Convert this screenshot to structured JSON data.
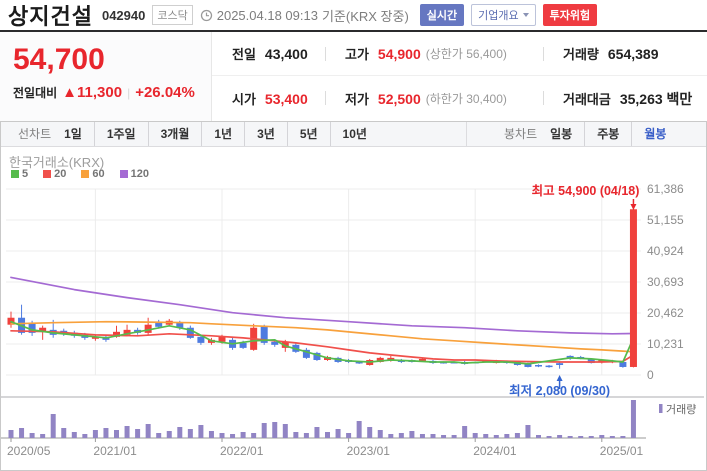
{
  "header": {
    "title": "상지건설",
    "code": "042940",
    "market_badge": "코스닥",
    "timestamp": "2025.04.18 09:13",
    "timestamp_suffix": "기준(KRX 장중)",
    "badges": {
      "realtime": "실시간",
      "company_overview": "기업개요",
      "investment_risk": "투자위험"
    }
  },
  "price_summary": {
    "current_price": "54,700",
    "change_label": "전일대비",
    "change_value": "▲11,300",
    "change_percent": "+26.04%",
    "stats": [
      {
        "label": "전일",
        "value": "43,400",
        "extra": ""
      },
      {
        "label": "고가",
        "value": "54,900",
        "extra": "(상한가 56,400)"
      },
      {
        "label": "거래량",
        "value": "654,389",
        "extra": ""
      },
      {
        "label": "시가",
        "value": "53,400",
        "extra": ""
      },
      {
        "label": "저가",
        "value": "52,500",
        "extra": "(하한가 30,400)"
      },
      {
        "label": "거래대금",
        "value": "35,263 백만",
        "extra": ""
      }
    ]
  },
  "toolbar": {
    "line_chart_label": "선차트",
    "line_tabs": [
      "1일",
      "1주일",
      "3개월",
      "1년",
      "3년",
      "5년",
      "10년"
    ],
    "candle_chart_label": "봉차트",
    "candle_tabs": [
      "일봉",
      "주봉",
      "월봉"
    ],
    "active_candle_tab": "월봉"
  },
  "chart": {
    "source": "한국거래소(KRX)",
    "ma_legend": [
      {
        "label": "5",
        "color": "#56bb4c"
      },
      {
        "label": "20",
        "color": "#f0504b"
      },
      {
        "label": "60",
        "color": "#f8a13c"
      },
      {
        "label": "120",
        "color": "#a46ad3"
      }
    ],
    "volume_legend": "거래량"
  },
  "chart_data": {
    "type": "candlestick+volume",
    "period": "monthly",
    "start_month": "2020-05",
    "end_month": "2025-04",
    "y_axis": {
      "max": 61386,
      "ticks": [
        61386,
        51155,
        40924,
        30693,
        20462,
        10231,
        0
      ]
    },
    "x_ticks": [
      {
        "label": "2020/05",
        "index": 0
      },
      {
        "label": "2021/01",
        "index": 8
      },
      {
        "label": "2022/01",
        "index": 20
      },
      {
        "label": "2023/01",
        "index": 32
      },
      {
        "label": "2024/01",
        "index": 44
      },
      {
        "label": "2025/01",
        "index": 56
      }
    ],
    "candles": [
      [
        16600,
        20900,
        15600,
        18900
      ],
      [
        18900,
        23200,
        13300,
        13900
      ],
      [
        17250,
        17900,
        12900,
        13900
      ],
      [
        14250,
        16300,
        11600,
        15600
      ],
      [
        14900,
        18200,
        12300,
        13250
      ],
      [
        14600,
        15300,
        12900,
        13600
      ],
      [
        13950,
        14600,
        12300,
        12950
      ],
      [
        13250,
        13900,
        11600,
        12250
      ],
      [
        11950,
        13250,
        11300,
        12600
      ],
      [
        12600,
        13250,
        10950,
        11600
      ],
      [
        12600,
        16250,
        12300,
        14250
      ],
      [
        13250,
        16600,
        12900,
        14900
      ],
      [
        14900,
        15600,
        13300,
        13900
      ],
      [
        13900,
        18900,
        13250,
        16600
      ],
      [
        17250,
        18200,
        15300,
        15900
      ],
      [
        16600,
        18500,
        16200,
        17900
      ],
      [
        17250,
        17900,
        14900,
        15600
      ],
      [
        15600,
        16300,
        11950,
        12250
      ],
      [
        12600,
        13300,
        9950,
        10600
      ],
      [
        10600,
        12250,
        9950,
        11600
      ],
      [
        10950,
        13300,
        10300,
        12600
      ],
      [
        11600,
        12300,
        8300,
        8950
      ],
      [
        10600,
        11300,
        8600,
        8950
      ],
      [
        8300,
        16900,
        8000,
        15600
      ],
      [
        15900,
        16600,
        9950,
        10600
      ],
      [
        10950,
        11600,
        9300,
        9950
      ],
      [
        8950,
        11600,
        7650,
        10950
      ],
      [
        9950,
        10600,
        7300,
        7650
      ],
      [
        8300,
        8950,
        5300,
        5650
      ],
      [
        7300,
        7650,
        4650,
        4950
      ],
      [
        4950,
        6300,
        4650,
        5950
      ],
      [
        5650,
        6000,
        4000,
        4300
      ],
      [
        4950,
        5300,
        3950,
        4300
      ],
      [
        4300,
        4650,
        3650,
        3950
      ],
      [
        3300,
        5300,
        3100,
        4950
      ],
      [
        4300,
        6000,
        4100,
        5650
      ],
      [
        4650,
        6300,
        4400,
        5650
      ],
      [
        4950,
        5300,
        3950,
        4300
      ],
      [
        4950,
        5150,
        4100,
        4300
      ],
      [
        4650,
        5650,
        4400,
        5300
      ],
      [
        4650,
        4950,
        3650,
        3950
      ],
      [
        4300,
        4500,
        3750,
        3950
      ],
      [
        4300,
        4500,
        3800,
        3950
      ],
      [
        4300,
        4650,
        3400,
        3650
      ],
      [
        4300,
        4450,
        3900,
        3950
      ],
      [
        4300,
        5000,
        4100,
        4650
      ],
      [
        3950,
        5000,
        3800,
        4650
      ],
      [
        4650,
        4800,
        3700,
        3950
      ],
      [
        4300,
        4450,
        3100,
        3300
      ],
      [
        3950,
        4100,
        2500,
        2650
      ],
      [
        3300,
        3500,
        2600,
        2800
      ],
      [
        3100,
        3300,
        2400,
        2650
      ],
      [
        3900,
        4100,
        2080,
        3300
      ],
      [
        6300,
        6500,
        5000,
        5650
      ],
      [
        5950,
        6300,
        5200,
        5650
      ],
      [
        5300,
        5500,
        3800,
        3950
      ],
      [
        4300,
        5000,
        3800,
        4950
      ],
      [
        4300,
        5000,
        3900,
        4650
      ],
      [
        4300,
        4450,
        2400,
        2650
      ],
      [
        2650,
        54900,
        2500,
        54700
      ]
    ],
    "volume_rel": [
      8,
      10,
      5,
      4,
      24,
      10,
      6,
      4,
      8,
      10,
      8,
      12,
      9,
      14,
      5,
      7,
      11,
      9,
      13,
      7,
      5,
      4,
      6,
      5,
      15,
      16,
      14,
      6,
      5,
      11,
      6,
      9,
      5,
      17,
      11,
      8,
      4,
      5,
      7,
      4,
      4,
      3,
      3,
      12,
      5,
      4,
      3,
      4,
      5,
      13,
      3,
      2,
      3,
      2,
      2,
      2,
      3,
      2,
      2,
      38
    ],
    "ma": {
      "ma5": {
        "color": "#56bb4c",
        "points": [
          [
            0,
            17600
          ],
          [
            2,
            14900
          ],
          [
            4,
            13900
          ],
          [
            6,
            13250
          ],
          [
            8,
            12600
          ],
          [
            9,
            12250
          ],
          [
            11,
            13600
          ],
          [
            13,
            14900
          ],
          [
            15,
            16250
          ],
          [
            17,
            14900
          ],
          [
            19,
            11300
          ],
          [
            21,
            10300
          ],
          [
            23,
            11300
          ],
          [
            25,
            11600
          ],
          [
            26,
            9600
          ],
          [
            28,
            7650
          ],
          [
            30,
            5650
          ],
          [
            32,
            4650
          ],
          [
            34,
            4300
          ],
          [
            36,
            4950
          ],
          [
            38,
            4650
          ],
          [
            40,
            4300
          ],
          [
            42,
            4300
          ],
          [
            43,
            3950
          ],
          [
            45,
            4300
          ],
          [
            47,
            4300
          ],
          [
            49,
            3650
          ],
          [
            51,
            4650
          ],
          [
            53,
            5650
          ],
          [
            55,
            5300
          ],
          [
            57,
            4650
          ],
          [
            58,
            4300
          ],
          [
            59,
            12250
          ]
        ]
      },
      "ma20": {
        "color": "#f0504b",
        "points": [
          [
            0,
            14600
          ],
          [
            4,
            14250
          ],
          [
            8,
            13250
          ],
          [
            12,
            12950
          ],
          [
            15,
            13600
          ],
          [
            19,
            12950
          ],
          [
            22,
            12250
          ],
          [
            25,
            11300
          ],
          [
            27,
            10600
          ],
          [
            30,
            9300
          ],
          [
            32,
            8300
          ],
          [
            34,
            7300
          ],
          [
            36,
            6600
          ],
          [
            38,
            5950
          ],
          [
            40,
            5300
          ],
          [
            42,
            4950
          ],
          [
            44,
            4950
          ],
          [
            46,
            4650
          ],
          [
            48,
            4500
          ],
          [
            50,
            4400
          ],
          [
            52,
            4300
          ],
          [
            54,
            4300
          ],
          [
            56,
            4300
          ],
          [
            58,
            4500
          ],
          [
            59,
            6600
          ]
        ]
      },
      "ma60": {
        "color": "#f8a13c",
        "points": [
          [
            0,
            16900
          ],
          [
            4,
            17250
          ],
          [
            9,
            17600
          ],
          [
            13,
            17450
          ],
          [
            17,
            17250
          ],
          [
            19,
            16900
          ],
          [
            23,
            16250
          ],
          [
            27,
            15600
          ],
          [
            30,
            14900
          ],
          [
            33,
            13900
          ],
          [
            36,
            12950
          ],
          [
            39,
            11950
          ],
          [
            42,
            11300
          ],
          [
            45,
            10600
          ],
          [
            48,
            9950
          ],
          [
            51,
            9300
          ],
          [
            54,
            8600
          ],
          [
            56,
            8300
          ],
          [
            58,
            7900
          ],
          [
            59,
            7650
          ]
        ]
      },
      "ma120": {
        "color": "#a46ad3",
        "points": [
          [
            0,
            32200
          ],
          [
            6,
            28200
          ],
          [
            11,
            25550
          ],
          [
            16,
            23200
          ],
          [
            21,
            20550
          ],
          [
            26,
            18900
          ],
          [
            32,
            17600
          ],
          [
            38,
            16250
          ],
          [
            43,
            15600
          ],
          [
            48,
            14600
          ],
          [
            53,
            13900
          ],
          [
            57,
            13600
          ],
          [
            59,
            13700
          ]
        ]
      }
    },
    "annotations": {
      "high": {
        "label": "최고 54,900 (04/18)",
        "index": 59,
        "price": 54900
      },
      "low": {
        "label": "최저 2,080 (09/30)",
        "index": 52,
        "price": 2080
      }
    },
    "colors": {
      "up": "#f0413c",
      "down": "#4e7be0",
      "volume": "#9184c4",
      "grid": "#ececec",
      "axis_text": "#8c8c8c",
      "high_label": "#e8262d",
      "low_label": "#3465d0"
    }
  }
}
